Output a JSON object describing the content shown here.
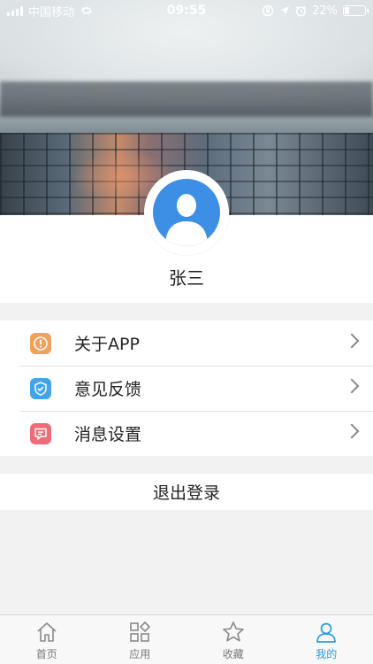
{
  "status_bar": {
    "carrier": "中国移动",
    "time": "09:55",
    "battery": "22%",
    "battery_level": 0.22
  },
  "profile": {
    "username": "张三"
  },
  "menu": {
    "items": [
      {
        "label": "关于APP",
        "icon": "info-icon",
        "color": "#f0a15c"
      },
      {
        "label": "意见反馈",
        "icon": "shield-check-icon",
        "color": "#3fa5ef"
      },
      {
        "label": "消息设置",
        "icon": "message-icon",
        "color": "#ee6b77"
      }
    ]
  },
  "logout": {
    "label": "退出登录"
  },
  "tabbar": {
    "tabs": [
      {
        "label": "首页",
        "icon": "home-icon"
      },
      {
        "label": "应用",
        "icon": "apps-icon"
      },
      {
        "label": "收藏",
        "icon": "star-icon"
      },
      {
        "label": "我的",
        "icon": "user-icon",
        "active": true
      }
    ],
    "active_color": "#2a9be0"
  }
}
